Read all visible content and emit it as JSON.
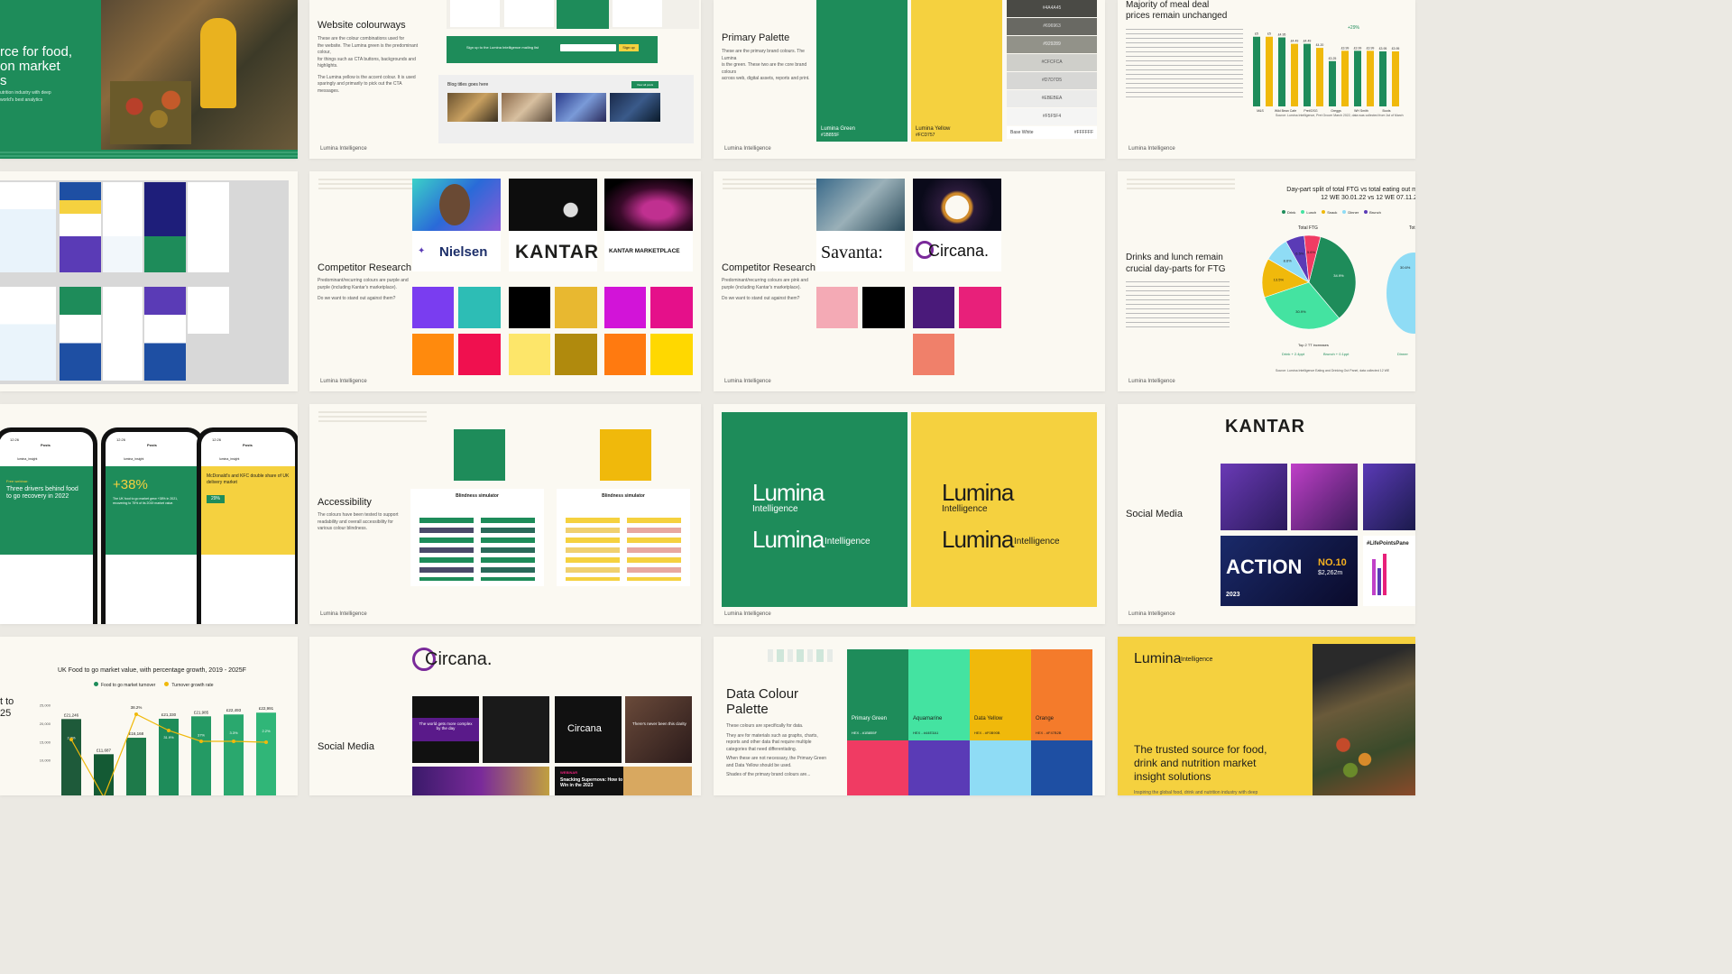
{
  "colors": {
    "green": "#1e8c5a",
    "yellow": "#f5d13f",
    "dark": "#1d1d1b",
    "cream": "#fbf9f2",
    "orange": "#f47b2b",
    "blue": "#1e4fa3",
    "pink": "#f03b63",
    "purple": "#5a3bb6",
    "aqua": "#44e3a1",
    "skyblue": "#8fdcf5"
  },
  "slide_hero": {
    "lines": [
      "rce for food,",
      "on market",
      "s"
    ],
    "sub": [
      "utrition industry with deep",
      "world's best analytics"
    ]
  },
  "slide_web": {
    "title": "Website colourways",
    "body": [
      "These are the colour combinations used for",
      "the website. The Lumina green is the predominant colour,",
      "for things such as CTA buttons, backgrounds and highlights."
    ],
    "body2": [
      "The Lumina yellow is the accent colour. It is used",
      "sparingly and primarily to pick out the CTA messages."
    ],
    "signup": "Sign up to the Lumina Intelligence mailing list",
    "signup_btn": "Sign up",
    "blog_title": "Blog titles goes here",
    "view_all": "View all posts",
    "foot": "Lumina Intelligence"
  },
  "slide_palette": {
    "title": "Primary Palette",
    "body": [
      "These are the primary brand colours. The Lumina",
      "is the green. These two are the core brand colours",
      "across web, digital assets, reports and print."
    ],
    "green_name": "Lumina Green",
    "green_hex": "#1B855F",
    "yellow_name": "Lumina Yellow",
    "yellow_hex": "#FCD757",
    "greys": [
      {
        "hex": "#4A4A45",
        "bg": "#4a4a45",
        "fg": "#ddd"
      },
      {
        "hex": "#696963",
        "bg": "#696963",
        "fg": "#ddd"
      },
      {
        "hex": "#929289",
        "bg": "#929289",
        "fg": "#eee"
      },
      {
        "hex": "#CFCFCA",
        "bg": "#cfcfca",
        "fg": "#555"
      },
      {
        "hex": "#D7D7D5",
        "bg": "#d7d7d5",
        "fg": "#555"
      },
      {
        "hex": "#EBEBEA",
        "bg": "#ebebea",
        "fg": "#555"
      },
      {
        "hex": "#F5F5F4",
        "bg": "#f5f5f4",
        "fg": "#555"
      }
    ],
    "base_white": "Base White",
    "base_white_hex": "#FFFFFF",
    "foot": "Lumina Intelligence"
  },
  "slide_meal": {
    "title": [
      "Majority of meal deal",
      "prices remain unchanged"
    ],
    "labels": [
      "£5",
      "£5",
      "£4.95",
      "£4.49",
      "£4.49",
      "£4.20",
      "£3.25",
      "£3.99",
      "£3.99",
      "£3.99",
      "£3.95",
      "£3.95"
    ],
    "cats": [
      "M&S",
      "",
      "Wild Bean Cafe",
      "",
      "Pret/OSG",
      "",
      "Greggs",
      "",
      "WH Smith",
      "",
      "Boots",
      ""
    ],
    "vals": [
      5,
      5,
      4.95,
      4.49,
      4.49,
      4.2,
      3.25,
      3.99,
      3.99,
      3.99,
      3.95,
      3.95
    ],
    "pct": "+29%",
    "source": "Source: Lumina Intelligence, Pret Grocer March 2022, data was collected from 1st of March",
    "foot": "Lumina Intelligence"
  },
  "slide_comp1": {
    "title": "Competitor Research",
    "body": [
      "Predominant/recurring colours are purple and",
      "purple (including Kantar's marketplace)."
    ],
    "q": "Do we want to stand out against them?",
    "brands": [
      "Nielsen",
      "KANTAR",
      "KANTAR MARKETPLACE"
    ],
    "foot": "Lumina Intelligence"
  },
  "slide_comp2": {
    "title": "Competitor Research",
    "body": [
      "Predominant/recurring colours are pink and",
      "purple (including Kantar's marketplace)."
    ],
    "q": "Do we want to stand out against them?",
    "brands": [
      "Savanta:",
      "Circana."
    ],
    "foot": "Lumina Intelligence"
  },
  "slide_pie": {
    "title": [
      "Drinks and lunch remain",
      "crucial day-parts for FTG"
    ],
    "chart_title": [
      "Day-part split of total FTG vs total eating out m",
      "12 WE 30.01.22 vs 12 WE 07.11.2"
    ],
    "legend": [
      "Drink",
      "Lunch",
      "Snack",
      "Dinner",
      "Brunch"
    ],
    "pie_label": "Total FTG",
    "pie_label2": "Tot",
    "slice_labels": [
      "34.9%",
      "30.9%",
      "13.5%",
      "8.6%",
      "6.5%",
      "5.6%"
    ],
    "top_note": "Top 2 TT increases",
    "incr": [
      "Drink + 2.4ppt",
      "Brunch + 0.1ppt",
      "Dinner"
    ],
    "side_label": "30.6%",
    "source": "Source: Lumina Intelligence Eating and Drinking Out Panel, data collected 12 WE",
    "foot": "Lumina Intelligence"
  },
  "slide_phones": {
    "p1_head": "Three drivers behind food to go recovery in 2022",
    "p1_kicker": "Free webinar:",
    "p2_big": "+38%",
    "p2_text": "The UK food to go market grew +38% in 2021, recovering to 75% of its 2019 market value.",
    "p3_text": "McDonald's and KFC double share of UK delivery market",
    "p3_pct": "29%",
    "handle": "lumina_insight",
    "posts": "Posts",
    "time": "12:26"
  },
  "slide_access": {
    "title": "Accessibility",
    "body": [
      "The colours have been tested to support",
      "readability and overall accessibility for",
      "various colour blindness."
    ],
    "sim_title": "Blindness simulator",
    "foot": "Lumina Intelligence"
  },
  "slide_logos": {
    "word": "Lumina",
    "sub": "Intelligence",
    "foot": "Lumina Intelligence"
  },
  "slide_social_kantar": {
    "title": "Social Media",
    "brand": "KANTAR",
    "action": "ACTION",
    "no": "NO.10",
    "amount": "$2,262m",
    "year": "2023",
    "hashtag": "#LifePointsPane",
    "foot": "Lumina Intelligence"
  },
  "slide_ftg": {
    "title": "UK Food to go market value, with percentage growth, 2019 - 2025F",
    "legend": [
      "Food to go market turnover",
      "Turnover growth rate"
    ],
    "left_lines": [
      "t to",
      "25"
    ],
    "bars": [
      {
        "label": "£21,246",
        "v": 21246,
        "pct": "2.2%"
      },
      {
        "label": "£11,687",
        "v": 11687,
        "pct": ""
      },
      {
        "label": "£16,168",
        "v": 16168,
        "pct": ""
      },
      {
        "label": "£21,330",
        "v": 21330,
        "pct": "31.9%"
      },
      {
        "label": "£21,985",
        "v": 21985,
        "pct": "37%"
      },
      {
        "label": "£22,493",
        "v": 22493,
        "pct": "3.3%"
      },
      {
        "label": "£22,991",
        "v": 22991,
        "pct": "2.2%"
      }
    ],
    "top_pct": "38.2%",
    "ylabels": [
      "25,000",
      "20,000",
      "15,000",
      "10,000"
    ],
    "yticks": [
      25000,
      20000,
      15000,
      10000
    ]
  },
  "slide_social_circana": {
    "title": "Social Media",
    "brand": "Circana.",
    "t1": "The world gets more complex by the day",
    "t2": "There's never been this clarity",
    "logo_small": "Circana",
    "t3": "Snacking Supernova: How to Win in the 2023",
    "webinar": "WEBINAR"
  },
  "slide_data": {
    "title": [
      "Data Colour",
      "Palette"
    ],
    "body": [
      "These colours are specifically for data.",
      "They are for materials such as graphs, charts, reports and other data that require multiple categories that need differentiating.",
      "When these are not necessary, the Primary Green and Data Yellow should be used.",
      "Shades of the primary brand colours are..."
    ],
    "cols": [
      {
        "name": "Primary Green",
        "hex": "HEX - #1B855F",
        "bg": "#1e8c5a",
        "fg": "#fff"
      },
      {
        "name": "Aquamarine",
        "hex": "HEX - #44E3A1",
        "bg": "#44e3a1",
        "fg": "#1d1d1b"
      },
      {
        "name": "Data Yellow",
        "hex": "HEX - #F0B90B",
        "bg": "#f0b90b",
        "fg": "#1d1d1b"
      },
      {
        "name": "Orange",
        "hex": "HEX - #F47B2B",
        "bg": "#f47b2b",
        "fg": "#1d1d1b"
      }
    ],
    "row2": [
      "#f03b63",
      "#5a3bb6",
      "#8fdcf5",
      "#1e4fa3"
    ]
  },
  "slide_trusted": {
    "logo": "Lumina",
    "logo_sub": "Intelligence",
    "headline": [
      "The trusted source for food,",
      "drink and nutrition market",
      "insight solutions"
    ],
    "sub": "Inspiring the global food, drink and nutrition industry with deep"
  }
}
